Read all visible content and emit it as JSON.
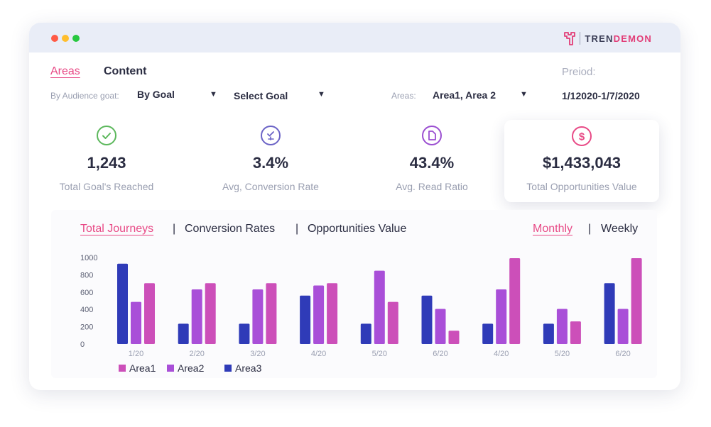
{
  "window": {
    "brand_part1": "TREN",
    "brand_part2": "DEMON"
  },
  "tabs": [
    {
      "label": "Areas",
      "active": true
    },
    {
      "label": "Content",
      "active": false
    }
  ],
  "filters": {
    "audience_label": "By Audience goat:",
    "goal_type_value": "By Goal",
    "goal_select_value": "Select Goal",
    "areas_label": "Areas:",
    "areas_value": "Area1, Area 2",
    "period_label": "Preiod:",
    "period_value": "1/12020-1/7/2020"
  },
  "kpis": [
    {
      "value": "1,243",
      "label": "Total Goal's Reached",
      "icon": "check-circle-icon",
      "color": "#5cb85c"
    },
    {
      "value": "3.4%",
      "label": "Avg, Conversion Rate",
      "icon": "conversion-icon",
      "color": "#6b63c6"
    },
    {
      "value": "43.4%",
      "label": "Avg. Read Ratio",
      "icon": "document-icon",
      "color": "#9b4fd1"
    },
    {
      "value": "$1,433,043",
      "label": "Total Opportunities Value",
      "icon": "dollar-icon",
      "color": "#e84a86"
    }
  ],
  "chart_tabs": {
    "items": [
      "Total Journeys",
      "Conversion Rates",
      "Opportunities Value"
    ],
    "active": 0,
    "separator": "|"
  },
  "period_tabs": {
    "items": [
      "Monthly",
      "Weekly"
    ],
    "active": 0,
    "separator": "|"
  },
  "colors": {
    "accent": "#e84a86",
    "area1": "#cc4fb9",
    "area2": "#a94fd8",
    "area3": "#2f3bb8"
  },
  "chart_data": {
    "type": "bar",
    "categories": [
      "1/20",
      "2/20",
      "3/20",
      "4/20",
      "5/20",
      "6/20",
      "4/20",
      "5/20",
      "6/20"
    ],
    "series": [
      {
        "name": "Area1",
        "values": [
          780,
          780,
          780,
          780,
          540,
          170,
          1100,
          290,
          1100
        ]
      },
      {
        "name": "Area2",
        "values": [
          540,
          700,
          700,
          750,
          940,
          450,
          700,
          450,
          450
        ]
      },
      {
        "name": "Area3",
        "values": [
          1030,
          260,
          260,
          620,
          260,
          620,
          260,
          260,
          780
        ]
      }
    ],
    "y_ticks": [
      0,
      200,
      400,
      600,
      800,
      1000
    ],
    "ylim": [
      0,
      1100
    ],
    "grid": false,
    "legend_position": "bottom-left"
  }
}
